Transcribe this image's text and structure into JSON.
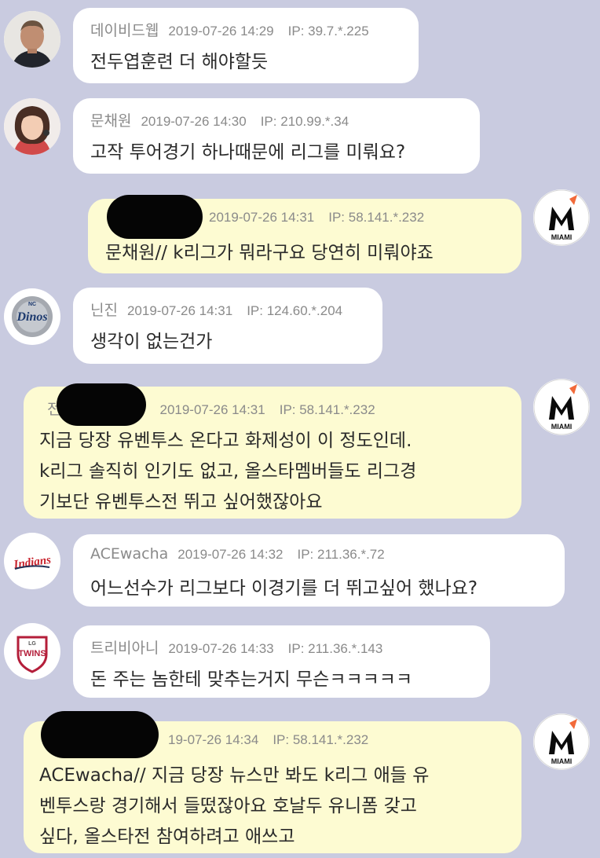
{
  "messages": [
    {
      "nick": "데이비드웹",
      "time": "2019-07-26 14:29",
      "ip": "IP: 39.7.*.225",
      "lines": [
        "전두엽훈련 더 해야할듯"
      ]
    },
    {
      "nick": "문채원",
      "time": "2019-07-26 14:30",
      "ip": "IP: 210.99.*.34",
      "lines": [
        "고작 투어경기 하나때문에 리그를 미뤄요?"
      ]
    },
    {
      "nick": "",
      "time": "2019-07-26 14:31",
      "ip": "IP: 58.141.*.232",
      "lines": [
        "문채원// k리그가 뭐라구요 당연히 미뤄야죠"
      ]
    },
    {
      "nick": "닌진",
      "time": "2019-07-26 14:31",
      "ip": "IP: 124.60.*.204",
      "lines": [
        "생각이 없는건가"
      ]
    },
    {
      "nick": "전",
      "time": "2019-07-26 14:31",
      "ip": "IP: 58.141.*.232",
      "lines": [
        "지금 당장 유벤투스 온다고 화제성이 이 정도인데.",
        "k리그 솔직히 인기도 없고, 올스타멤버들도 리그경",
        "기보단 유벤투스전 뛰고 싶어했잖아요"
      ]
    },
    {
      "nick": "ACEwacha",
      "time": "2019-07-26 14:32",
      "ip": "IP: 211.36.*.72",
      "lines": [
        "어느선수가 리그보다 이경기를 더 뛰고싶어 했나요?"
      ]
    },
    {
      "nick": "트리비아니",
      "time": "2019-07-26 14:33",
      "ip": "IP: 211.36.*.143",
      "lines": [
        "돈 주는 놈한테 맞추는거지 무슨ㅋㅋㅋㅋㅋ"
      ]
    },
    {
      "nick": "",
      "time": "19-07-26 14:34",
      "ip": "IP: 58.141.*.232",
      "lines": [
        "ACEwacha// 지금 당장 뉴스만 봐도 k리그 애들 유",
        "벤투스랑 경기해서 들떴잖아요 호날두 유니폼 갖고",
        "싶다, 올스타전 참여하려고 애쓰고"
      ]
    }
  ],
  "logos": {
    "marlins": "MIAMI",
    "dinos": "Dinos",
    "dinos_small": "NC",
    "indians": "Indians",
    "twins": "TWINS",
    "twins_small": "LG"
  },
  "colors": {
    "background": "#c9cbe0",
    "bubble_other": "#ffffff",
    "bubble_mine": "#fdfbd2",
    "meta_text": "#8a8a8a"
  }
}
